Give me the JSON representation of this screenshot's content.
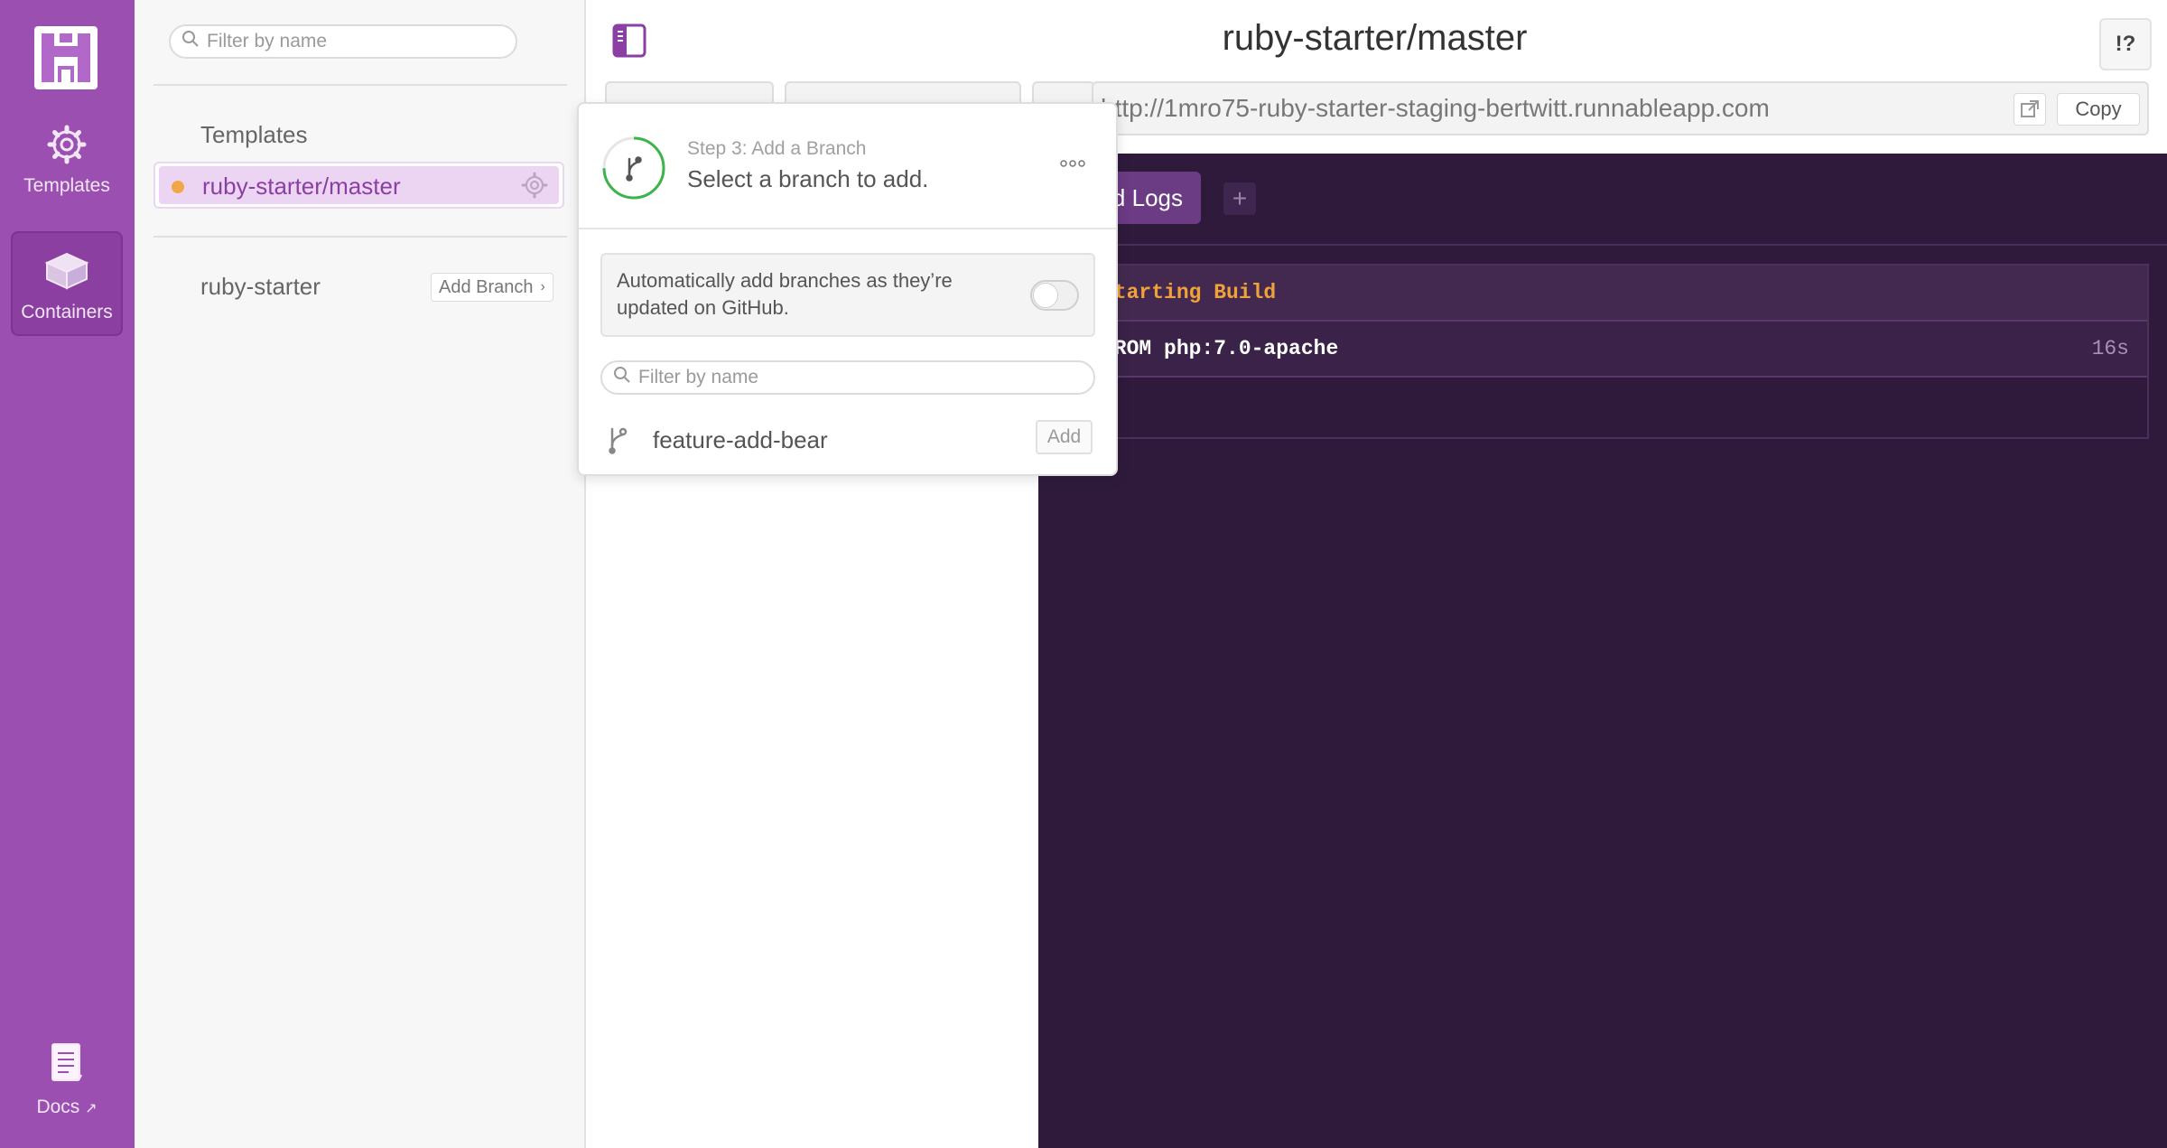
{
  "rail": {
    "templates_label": "Templates",
    "containers_label": "Containers",
    "docs_label": "Docs"
  },
  "sidebar": {
    "search_placeholder": "Filter by name",
    "section_heading": "Templates",
    "selected_item": "ruby-starter/master",
    "repo_name": "ruby-starter",
    "add_branch_label": "Add Branch"
  },
  "main": {
    "title": "ruby-starter/master",
    "help_label": "!?",
    "url": "http://1mro75-ruby-starter-staging-bertwitt.runnableapp.com",
    "copy_label": "Copy",
    "log_tab_label": "Build Logs",
    "log_add_label": "+",
    "log_lines": [
      {
        "text": "Starting Build",
        "time": ""
      },
      {
        "text": "FROM php:7.0-apache",
        "time": "16s"
      }
    ]
  },
  "popover": {
    "step_label": "Step 3: Add a Branch",
    "title": "Select a branch to add.",
    "auto_add_text": "Automatically add branches as they’re updated on GitHub.",
    "auto_add_enabled": false,
    "search_placeholder": "Filter by name",
    "branches": [
      {
        "name": "feature-add-bear",
        "action_label": "Add"
      }
    ]
  },
  "colors": {
    "rail_purple": "#9b4fb1",
    "log_bg": "#2f1a3c",
    "selected_bg": "#ecd5f3",
    "status_dot": "#f2a64a",
    "progress_green": "#3bb54a"
  }
}
